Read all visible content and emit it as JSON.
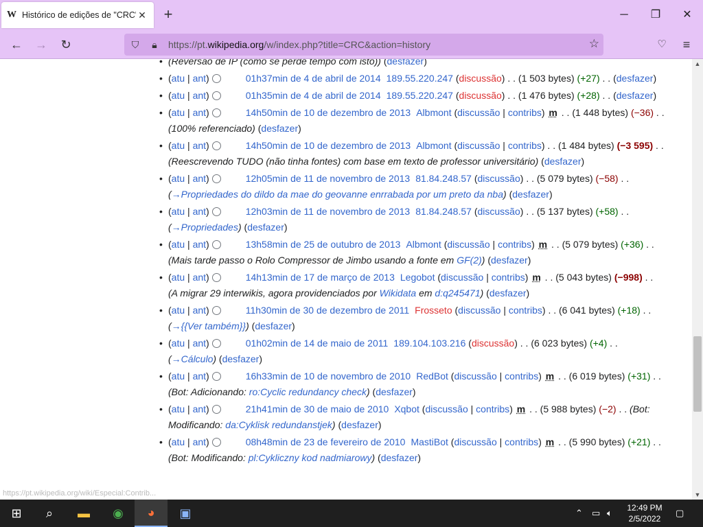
{
  "browser": {
    "tab_title": "Histórico de edições de \"CRC\" -",
    "tab_favicon": "W",
    "url_prefix": "https://pt.",
    "url_domain": "wikipedia.org",
    "url_path": "/w/index.php?title=CRC&action=history",
    "status_url": "https://pt.wikipedia.org/wiki/Especial:Contrib..."
  },
  "history": {
    "first_comment": "(Reversão de IP (como se perde tempo com isto))",
    "first_undo": "desfazer",
    "rows": [
      {
        "date": "01h37min de 4 de abril de 2014",
        "user": "189.55.220.247",
        "talk": "discussão",
        "size": "(1 503 bytes)",
        "diff": "+27",
        "undo": "desfazer"
      },
      {
        "date": "01h35min de 4 de abril de 2014",
        "user": "189.55.220.247",
        "talk": "discussão",
        "size": "(1 476 bytes)",
        "diff": "+28",
        "undo": "desfazer"
      },
      {
        "date": "14h50min de 10 de dezembro de 2013",
        "user": "Albmont",
        "talk": "discussão",
        "contribs": "contribs",
        "minor": "m",
        "size": "(1 448 bytes)",
        "diff": "−36",
        "comment": "(100% referenciado)",
        "undo": "desfazer"
      },
      {
        "date": "14h50min de 10 de dezembro de 2013",
        "user": "Albmont",
        "talk": "discussão",
        "contribs": "contribs",
        "size": "(1 484 bytes)",
        "diff": "−3 595",
        "comment": "(Reescrevendo TUDO (não tinha fontes) com base em texto de professor universitário)",
        "undo": "desfazer"
      },
      {
        "date": "12h05min de 11 de novembro de 2013",
        "user": "81.84.248.57",
        "talk": "discussão",
        "size": "(5 079 bytes)",
        "diff": "−58",
        "section": "Propriedades do dildo da mae do geovanne enrrabada por um preto da nba",
        "undo": "desfazer"
      },
      {
        "date": "12h03min de 11 de novembro de 2013",
        "user": "81.84.248.57",
        "talk": "discussão",
        "size": "(5 137 bytes)",
        "diff": "+58",
        "section": "Propriedades",
        "undo": "desfazer"
      },
      {
        "date": "13h58min de 25 de outubro de 2013",
        "user": "Albmont",
        "talk": "discussão",
        "contribs": "contribs",
        "minor": "m",
        "size": "(5 079 bytes)",
        "diff": "+36",
        "comment_a": "(Mais tarde passo o Rolo Compressor de Jimbo usando a fonte em",
        "comment_link": "GF(2)",
        "comment_b": ")",
        "undo": "desfazer"
      },
      {
        "date": "14h13min de 17 de março de 2013",
        "user": "Legobot",
        "talk": "discussão",
        "contribs": "contribs",
        "minor": "m",
        "size": "(5 043 bytes)",
        "diff": "−998",
        "comment_a": "(A migrar 29 interwikis, agora providenciados por",
        "comment_link": "Wikidata",
        "comment_mid": "em",
        "comment_link2": "d:q245471",
        "comment_b": ")",
        "undo": "desfazer"
      },
      {
        "date": "11h30min de 30 de dezembro de 2011",
        "user": "Frosseto",
        "talk": "discussão",
        "contribs": "contribs",
        "size": "(6 041 bytes)",
        "diff": "+18",
        "section": "{{Ver também}}",
        "undo": "desfazer"
      },
      {
        "date": "01h02min de 14 de maio de 2011",
        "user": "189.104.103.216",
        "talk": "discussão",
        "size": "(6 023 bytes)",
        "diff": "+4",
        "section": "Cálculo",
        "undo": "desfazer"
      },
      {
        "date": "16h33min de 10 de novembro de 2010",
        "user": "RedBot",
        "talk": "discussão",
        "contribs": "contribs",
        "minor": "m",
        "size": "(6 019 bytes)",
        "diff": "+31",
        "comment_a": "(Bot: Adicionando:",
        "comment_link": "ro:Cyclic redundancy check",
        "comment_b": ")",
        "undo": "desfazer"
      },
      {
        "date": "21h41min de 30 de maio de 2010",
        "user": "Xqbot",
        "talk": "discussão",
        "contribs": "contribs",
        "minor": "m",
        "size": "(5 988 bytes)",
        "diff": "−2",
        "comment_a": "(Bot: Modificando:",
        "comment_link": "da:Cyklisk redundanstjek",
        "comment_b": ")",
        "undo": "desfazer"
      },
      {
        "date": "08h48min de 23 de fevereiro de 2010",
        "user": "MastiBot",
        "talk": "discussão",
        "contribs": "contribs",
        "minor": "m",
        "size": "(5 990 bytes)",
        "diff": "+21",
        "comment_a": "(Bot: Modificando:",
        "comment_link": "pl:Cykliczny kod nadmiarowy",
        "comment_b": ")",
        "undo": "desfazer"
      }
    ],
    "atu": "atu",
    "ant": "ant"
  },
  "taskbar": {
    "time": "12:49 PM",
    "date": "2/5/2022"
  },
  "colors": {
    "firefox_purple": "#e6c4f7",
    "urlbar": "#d4a8ea",
    "link": "#3366cc",
    "redlink": "#dd3333",
    "positive": "#006400",
    "negative": "#8b0000"
  }
}
